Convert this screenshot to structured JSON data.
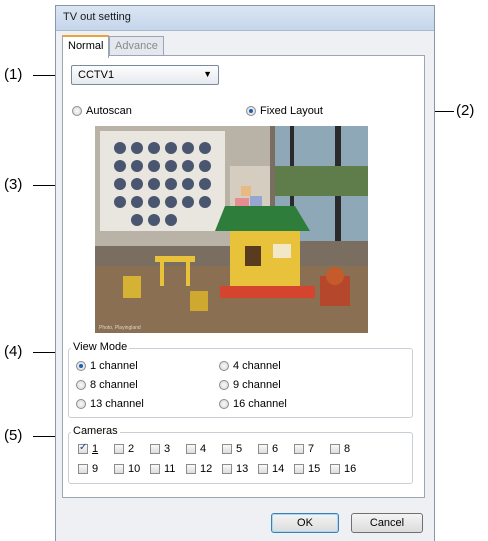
{
  "window": {
    "title": "TV out setting"
  },
  "tabs": [
    {
      "label": "Normal",
      "active": true
    },
    {
      "label": "Advance",
      "active": false
    }
  ],
  "device_select": {
    "value": "CCTV1"
  },
  "scan": {
    "autoscan_label": "Autoscan",
    "fixed_layout_label": "Fixed Layout",
    "selected": "Fixed Layout"
  },
  "preview": {
    "caption": "Photo, Playingland"
  },
  "view_mode": {
    "title": "View Mode",
    "options": [
      "1 channel",
      "4 channel",
      "8 channel",
      "9 channel",
      "13 channel",
      "16 channel"
    ],
    "selected": "1 channel"
  },
  "cameras": {
    "title": "Cameras",
    "labels": [
      "1",
      "2",
      "3",
      "4",
      "5",
      "6",
      "7",
      "8",
      "9",
      "10",
      "11",
      "12",
      "13",
      "14",
      "15",
      "16"
    ],
    "checked": [
      "1"
    ]
  },
  "buttons": {
    "ok": "OK",
    "cancel": "Cancel"
  },
  "callouts": [
    "(1)",
    "(2)",
    "(3)",
    "(4)",
    "(5)"
  ],
  "colors": {
    "radio_selected": "#1d5fb4",
    "active_tab_accent": "#e8a33b"
  }
}
